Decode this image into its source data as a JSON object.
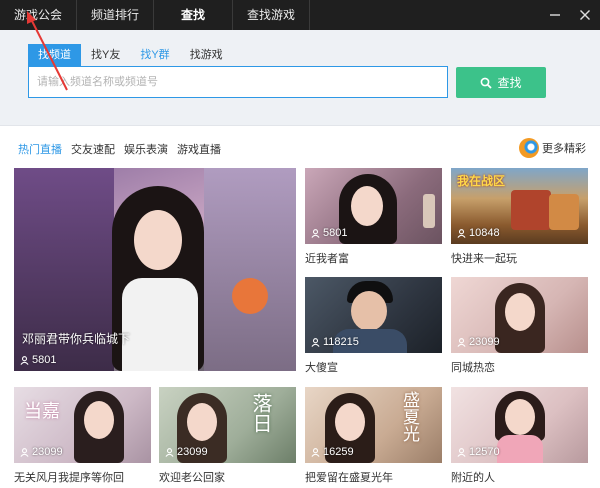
{
  "topnav": {
    "tabs": [
      {
        "label": "游戏公会"
      },
      {
        "label": "频道排行"
      },
      {
        "label": "查找"
      },
      {
        "label": "查找游戏"
      }
    ]
  },
  "search": {
    "tabs": [
      {
        "label": "找频道"
      },
      {
        "label": "找Y友"
      },
      {
        "label": "找Y群"
      },
      {
        "label": "找游戏"
      }
    ],
    "placeholder": "请输入频道名称或频道号",
    "button_label": "查找"
  },
  "categories": {
    "tabs": [
      {
        "label": "热门直播"
      },
      {
        "label": "交友速配"
      },
      {
        "label": "娱乐表演"
      },
      {
        "label": "游戏直播"
      }
    ],
    "more_label": "更多精彩"
  },
  "cards": [
    {
      "title": "邓丽君带你兵临城下",
      "count": "5801"
    },
    {
      "title": "近我者富",
      "count": "5801"
    },
    {
      "title": "快进来一起玩",
      "count": "10848"
    },
    {
      "title": "大傻宣",
      "count": "118215"
    },
    {
      "title": "同城热恋",
      "count": "23099"
    },
    {
      "title": "无关风月我提序等你回",
      "count": "23099"
    },
    {
      "title": "欢迎老公回家",
      "count": "23099"
    },
    {
      "title": "把爱留在盛夏光年",
      "count": "16259"
    },
    {
      "title": "附近的人",
      "count": "12570"
    }
  ],
  "thumb_texts": {
    "game_banner": "我在战区",
    "card6_text": "当嘉",
    "card7_text": "落日",
    "card8_text": "盛夏光"
  },
  "icons": {
    "minimize": "minimize-icon",
    "close": "close-icon",
    "search": "search-icon",
    "viewer": "person-icon"
  },
  "colors": {
    "accent": "#2e98e6",
    "search_button": "#3cc28a",
    "topbar": "#1f1f1f",
    "annotation": "#e53935"
  }
}
